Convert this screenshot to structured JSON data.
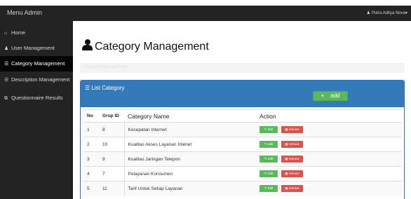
{
  "header": {
    "brand": "Menu Admin",
    "user_name": "Putra Aditya Nova",
    "user_icon": "user-icon",
    "caret": "▾"
  },
  "sidebar": {
    "items": [
      {
        "label": "Home",
        "icon": "home-icon",
        "active": false
      },
      {
        "label": "User Management",
        "icon": "user-icon",
        "active": false
      },
      {
        "label": "Category Management",
        "icon": "list-icon",
        "active": true
      },
      {
        "label": "Description Management",
        "icon": "list-icon",
        "active": false
      },
      {
        "label": "Questionnaire Results",
        "icon": "external-link-icon",
        "active": false
      }
    ]
  },
  "page": {
    "title": "Category Management",
    "title_icon": "user-icon",
    "breadcrumb": "Category Management"
  },
  "panel": {
    "title": "List Category",
    "title_icon": "list-icon",
    "add_label": "add",
    "add_icon": "plus-icon"
  },
  "table": {
    "headers": [
      "No",
      "Grup ID",
      "Category Name",
      "Action"
    ],
    "edit_label": "Edit",
    "remove_label": "remove",
    "rows": [
      {
        "no": "1",
        "grup_id": "8",
        "name": "Kecepatan Internet"
      },
      {
        "no": "2",
        "grup_id": "10",
        "name": "Kualitas Akses Layanan Intenet"
      },
      {
        "no": "3",
        "grup_id": "9",
        "name": "Kualitas Jaringan Telepon"
      },
      {
        "no": "4",
        "grup_id": "7",
        "name": "Pelayanan Konsumen"
      },
      {
        "no": "5",
        "grup_id": "11",
        "name": "Tarif Untuk Setiap Layanan"
      }
    ]
  },
  "colors": {
    "topbar": "#232323",
    "sidebar_active": "#060606",
    "panel_header": "#347ab8",
    "add_button": "#5cb85c",
    "edit_button": "#5cb85c",
    "remove_button": "#d9534f"
  }
}
